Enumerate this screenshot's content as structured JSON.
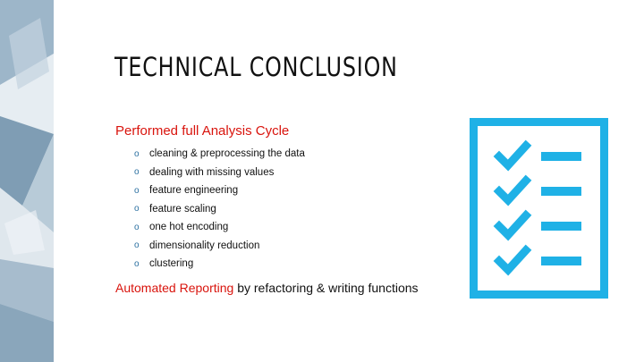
{
  "slide": {
    "title": "TECHNICAL CONCLUSION",
    "heading": "Performed full Analysis Cycle",
    "bullet_marker": "o",
    "bullets": [
      "cleaning & preprocessing the data",
      "dealing with missing values",
      "feature engineering",
      "feature scaling",
      "one hot encoding",
      "dimensionality reduction",
      "clustering"
    ],
    "footer_highlight": "Automated Reporting",
    "footer_rest": " by refactoring & writing functions"
  },
  "icons": {
    "checklist": "checklist-icon",
    "decoration": "geometric-strip"
  },
  "colors": {
    "accent_red": "#d9140d",
    "icon_blue": "#1fb1e6",
    "text": "#111111"
  }
}
